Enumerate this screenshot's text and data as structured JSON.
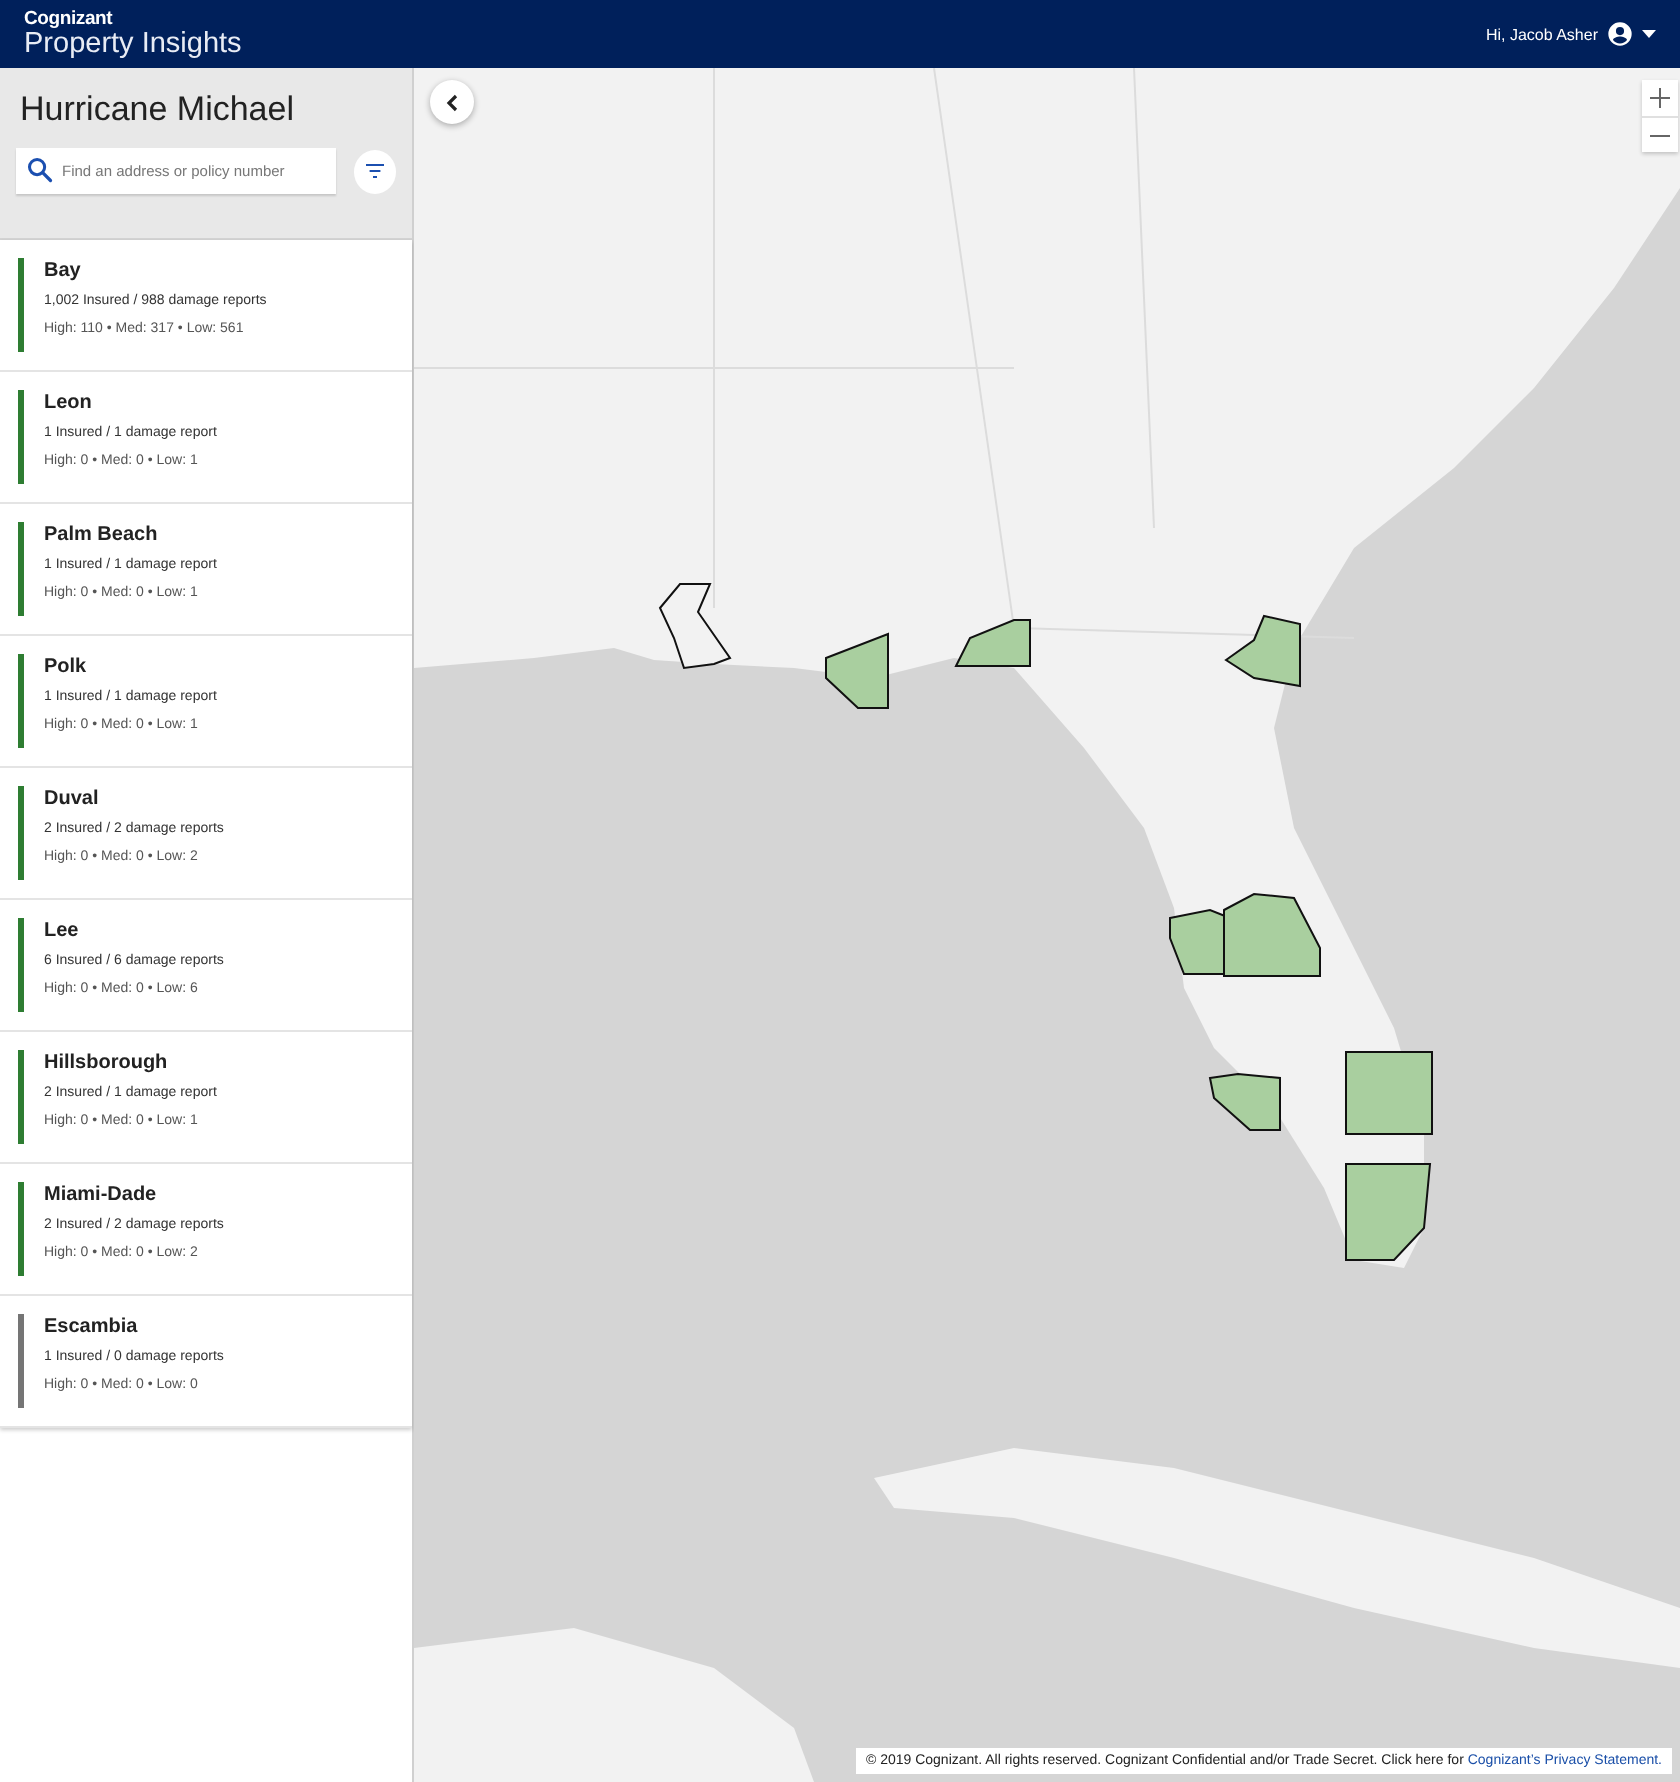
{
  "header": {
    "brand": "Cognizant",
    "product": "Property Insights",
    "greeting": "Hi, Jacob Asher"
  },
  "sidebar": {
    "title": "Hurricane Michael",
    "search": {
      "placeholder": "Find an address or policy number"
    }
  },
  "counties": [
    {
      "name": "Bay",
      "summary": "1,002 Insured / 988 damage reports",
      "breakdown": "High: 110 • Med: 317 • Low: 561",
      "color": "#2e7d32"
    },
    {
      "name": "Leon",
      "summary": "1 Insured / 1 damage report",
      "breakdown": "High: 0 • Med: 0 • Low: 1",
      "color": "#2e7d32"
    },
    {
      "name": "Palm Beach",
      "summary": "1 Insured / 1 damage report",
      "breakdown": "High: 0 • Med: 0 • Low: 1",
      "color": "#2e7d32"
    },
    {
      "name": "Polk",
      "summary": "1 Insured / 1 damage report",
      "breakdown": "High: 0 • Med: 0 • Low: 1",
      "color": "#2e7d32"
    },
    {
      "name": "Duval",
      "summary": "2 Insured / 2 damage reports",
      "breakdown": "High: 0 • Med: 0 • Low: 2",
      "color": "#2e7d32"
    },
    {
      "name": "Lee",
      "summary": "6 Insured / 6 damage reports",
      "breakdown": "High: 0 • Med: 0 • Low: 6",
      "color": "#2e7d32"
    },
    {
      "name": "Hillsborough",
      "summary": "2 Insured / 1 damage report",
      "breakdown": "High: 0 • Med: 0 • Low: 1",
      "color": "#2e7d32"
    },
    {
      "name": "Miami-Dade",
      "summary": "2 Insured / 2 damage reports",
      "breakdown": "High: 0 • Med: 0 • Low: 2",
      "color": "#2e7d32"
    },
    {
      "name": "Escambia",
      "summary": "1 Insured / 0 damage reports",
      "breakdown": "High: 0 • Med: 0 • Low: 0",
      "color": "#757575"
    }
  ],
  "map": {
    "footer": {
      "text": "© 2019 Cognizant. All rights reserved. Cognizant Confidential and/or Trade Secret. Click here for",
      "link": "Cognizant’s Privacy Statement."
    }
  }
}
